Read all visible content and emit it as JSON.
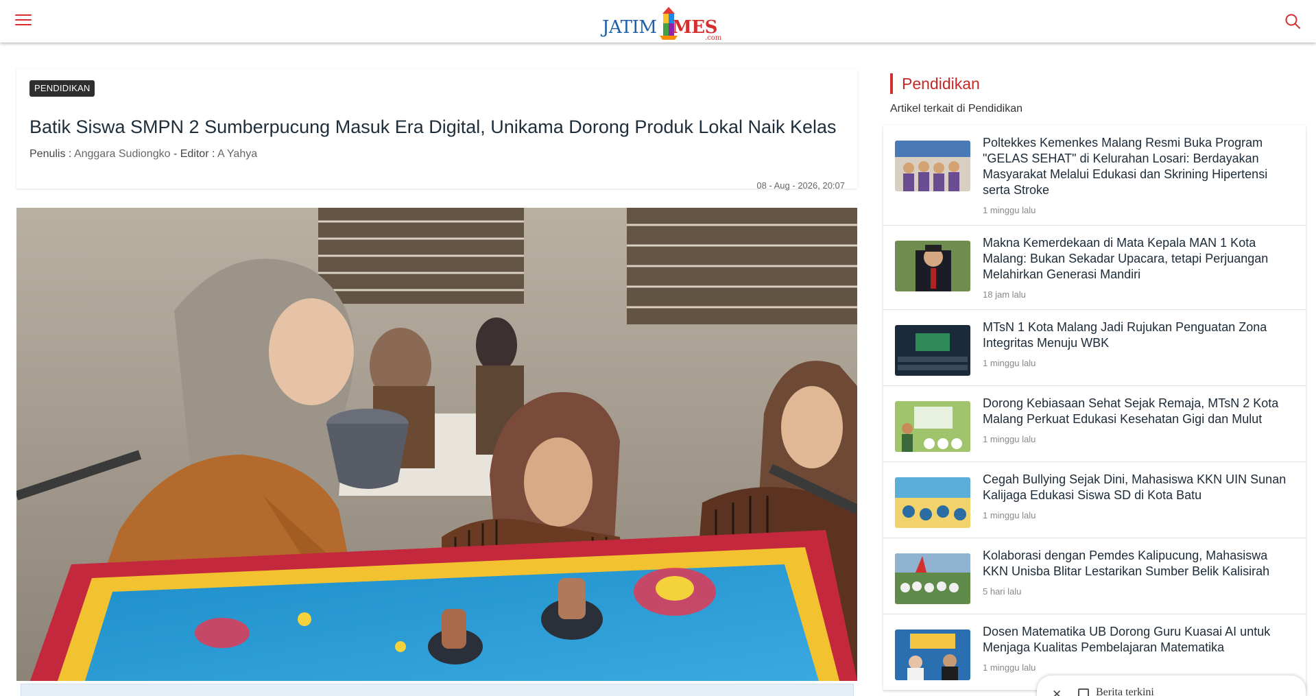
{
  "header": {
    "logo": {
      "main": "JATIM",
      "accent": "MES",
      "domain": ".com"
    },
    "menu_icon": "hamburger-menu-icon",
    "search_icon": "search-icon",
    "accent_color": "#d32f2f"
  },
  "article": {
    "category": "PENDIDIKAN",
    "title": "Batik Siswa SMPN 2 Sumberpucung Masuk Era Digital, Unikama Dorong Produk Lokal Naik Kelas",
    "writer_label": "Penulis :",
    "writer": "Anggara Sudiongko",
    "separator": " - ",
    "editor_label": "Editor :",
    "editor": "A Yahya",
    "date": "08 - Aug - 2026, 20:07"
  },
  "sidebar": {
    "heading": "Pendidikan",
    "subheading": "Artikel terkait di Pendidikan",
    "items": [
      {
        "title": "Poltekkes Kemenkes Malang Resmi Buka Program \"GELAS SEHAT\" di Kelurahan Losari: Berdayakan Masyarakat Melalui Edukasi dan Skrining Hipertensi serta Stroke",
        "time": "1 minggu lalu"
      },
      {
        "title": "Makna Kemerdekaan di Mata Kepala MAN 1 Kota Malang: Bukan Sekadar Upacara, tetapi Perjuangan Melahirkan Generasi Mandiri",
        "time": "18 jam lalu"
      },
      {
        "title": "MTsN 1 Kota Malang Jadi Rujukan Penguatan Zona Integritas Menuju WBK",
        "time": "1 minggu lalu"
      },
      {
        "title": "Dorong Kebiasaan Sehat Sejak Remaja, MTsN 2 Kota Malang Perkuat Edukasi Kesehatan Gigi dan Mulut",
        "time": "1 minggu lalu"
      },
      {
        "title": "Cegah Bullying Sejak Dini, Mahasiswa KKN UIN Sunan Kalijaga Edukasi Siswa SD di Kota Batu",
        "time": "1 minggu lalu"
      },
      {
        "title": "Kolaborasi dengan Pemdes Kalipucung, Mahasiswa KKN Unisba Blitar Lestarikan Sumber Belik Kalisirah",
        "time": "5 hari lalu"
      },
      {
        "title": "Dosen Matematika UB Dorong Guru Kuasai AI untuk Menjaga Kualitas Pembelajaran Matematika",
        "time": "1 minggu lalu"
      }
    ]
  },
  "latest_news": {
    "label": "Berita terkini",
    "close": "✕"
  }
}
